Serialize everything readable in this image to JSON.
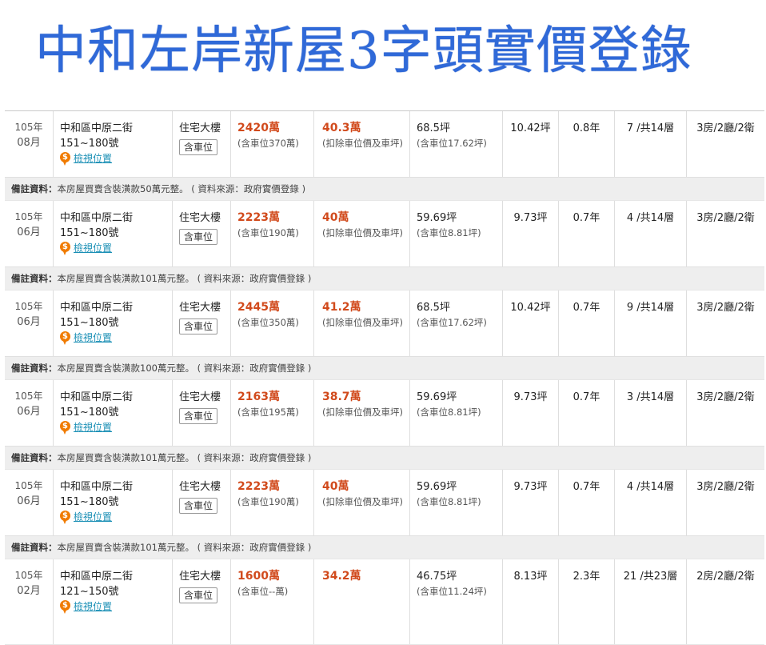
{
  "page": {
    "title": "中和左岸新屋3字頭實價登錄"
  },
  "labels": {
    "view_location": "檢視位置",
    "note_label": "備註資料：",
    "pin_symbol": "$"
  },
  "listings": [
    {
      "year": "105年",
      "month": "08月",
      "address_line1": "中和區中原二街",
      "address_line2": "151~180號",
      "type": "住宅大樓",
      "parking": "含車位",
      "total_price": "2420萬",
      "total_note": "(含車位370萬)",
      "unit_price": "40.3萬",
      "unit_note": "(扣除車位價及車坪)",
      "area": "68.5坪",
      "area_note": "(含車位17.62坪)",
      "main_area": "10.42坪",
      "age": "0.8年",
      "floor": "7 /共14層",
      "layout": "3房/2廳/2衛",
      "note": "本房屋買賣含裝潢款50萬元整。 ( 資料來源：政府實價登錄 )"
    },
    {
      "year": "105年",
      "month": "06月",
      "address_line1": "中和區中原二街",
      "address_line2": "151~180號",
      "type": "住宅大樓",
      "parking": "含車位",
      "total_price": "2223萬",
      "total_note": "(含車位190萬)",
      "unit_price": "40萬",
      "unit_note": "(扣除車位價及車坪)",
      "area": "59.69坪",
      "area_note": "(含車位8.81坪)",
      "main_area": "9.73坪",
      "age": "0.7年",
      "floor": "4 /共14層",
      "layout": "3房/2廳/2衛",
      "note": "本房屋買賣含裝潢款101萬元整。 ( 資料來源：政府實價登錄 )"
    },
    {
      "year": "105年",
      "month": "06月",
      "address_line1": "中和區中原二街",
      "address_line2": "151~180號",
      "type": "住宅大樓",
      "parking": "含車位",
      "total_price": "2445萬",
      "total_note": "(含車位350萬)",
      "unit_price": "41.2萬",
      "unit_note": "(扣除車位價及車坪)",
      "area": "68.5坪",
      "area_note": "(含車位17.62坪)",
      "main_area": "10.42坪",
      "age": "0.7年",
      "floor": "9 /共14層",
      "layout": "3房/2廳/2衛",
      "note": "本房屋買賣含裝潢款100萬元整。 ( 資料來源：政府實價登錄 )"
    },
    {
      "year": "105年",
      "month": "06月",
      "address_line1": "中和區中原二街",
      "address_line2": "151~180號",
      "type": "住宅大樓",
      "parking": "含車位",
      "total_price": "2163萬",
      "total_note": "(含車位195萬)",
      "unit_price": "38.7萬",
      "unit_note": "(扣除車位價及車坪)",
      "area": "59.69坪",
      "area_note": "(含車位8.81坪)",
      "main_area": "9.73坪",
      "age": "0.7年",
      "floor": "3 /共14層",
      "layout": "3房/2廳/2衛",
      "note": "本房屋買賣含裝潢款101萬元整。 ( 資料來源：政府實價登錄 )"
    },
    {
      "year": "105年",
      "month": "06月",
      "address_line1": "中和區中原二街",
      "address_line2": "151~180號",
      "type": "住宅大樓",
      "parking": "含車位",
      "total_price": "2223萬",
      "total_note": "(含車位190萬)",
      "unit_price": "40萬",
      "unit_note": "(扣除車位價及車坪)",
      "area": "59.69坪",
      "area_note": "(含車位8.81坪)",
      "main_area": "9.73坪",
      "age": "0.7年",
      "floor": "4 /共14層",
      "layout": "3房/2廳/2衛",
      "note": "本房屋買賣含裝潢款101萬元整。 ( 資料來源：政府實價登錄 )"
    },
    {
      "year": "105年",
      "month": "02月",
      "address_line1": "中和區中原二街",
      "address_line2": "121~150號",
      "type": "住宅大樓",
      "parking": "含車位",
      "total_price": "1600萬",
      "total_note": "(含車位--萬)",
      "unit_price": "34.2萬",
      "unit_note": "",
      "area": "46.75坪",
      "area_note": "(含車位11.24坪)",
      "main_area": "8.13坪",
      "age": "2.3年",
      "floor": "21 /共23層",
      "layout": "2房/2廳/2衛",
      "note": ""
    }
  ]
}
